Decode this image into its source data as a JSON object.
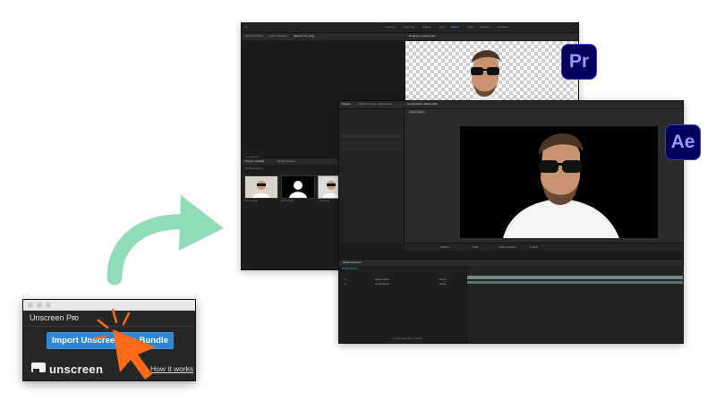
{
  "premiere": {
    "badge": "Pr",
    "badge_colors": {
      "bg": "#00005b",
      "fg": "#9999ff"
    },
    "workspace_tabs": [
      "Learning",
      "Assembly",
      "Editing",
      "Color",
      "Effects",
      "Audio",
      "Graphics",
      "Libraries"
    ],
    "source_tabs": [
      "Effect Controls",
      "Audio Clip Mixer",
      "Source: Fur_Kitty_"
    ],
    "program_tab": "Program: unscreened",
    "timecode": "00;00;00;00",
    "project_tabs": [
      "Project: Untitled",
      "Media Browser"
    ],
    "project_file": "Untitled.prproj",
    "thumbnails": [
      {
        "label": "unscreened"
      },
      {
        "label": "alpha matte"
      },
      {
        "label": "Unscreen"
      }
    ]
  },
  "after_effects": {
    "badge": "Ae",
    "badge_colors": {
      "bg": "#00005b",
      "fg": "#9999ff"
    },
    "project_tab": "Project",
    "effect_tab": "Effect Controls: alpha matte",
    "composition_tab": "Composition: alpha matte",
    "comp_subtab": "alpha matte",
    "timeline_tab": "alpha unscreen",
    "timecode": "0:00:00:00",
    "layers": [
      {
        "num": "1",
        "name": "alpha matte",
        "mode": "None"
      },
      {
        "num": "2",
        "name": "unscreened",
        "mode": "None"
      }
    ],
    "zoom": "(100%)",
    "quality": "(Full)",
    "camera": "Active Camera",
    "view": "1 View",
    "footer": "Toggle Switches / Modes"
  },
  "unscreen_panel": {
    "title": "Unscreen Pro",
    "menu_icon": "hamburger-icon",
    "button_label": "Import Unscreen Pro Bundle",
    "button_color": "#2f86d2",
    "logo_text": "unscreen",
    "link_text": "How it works"
  },
  "arrow_color": "#8fdcb6",
  "cursor_color": "#ff6a1a"
}
